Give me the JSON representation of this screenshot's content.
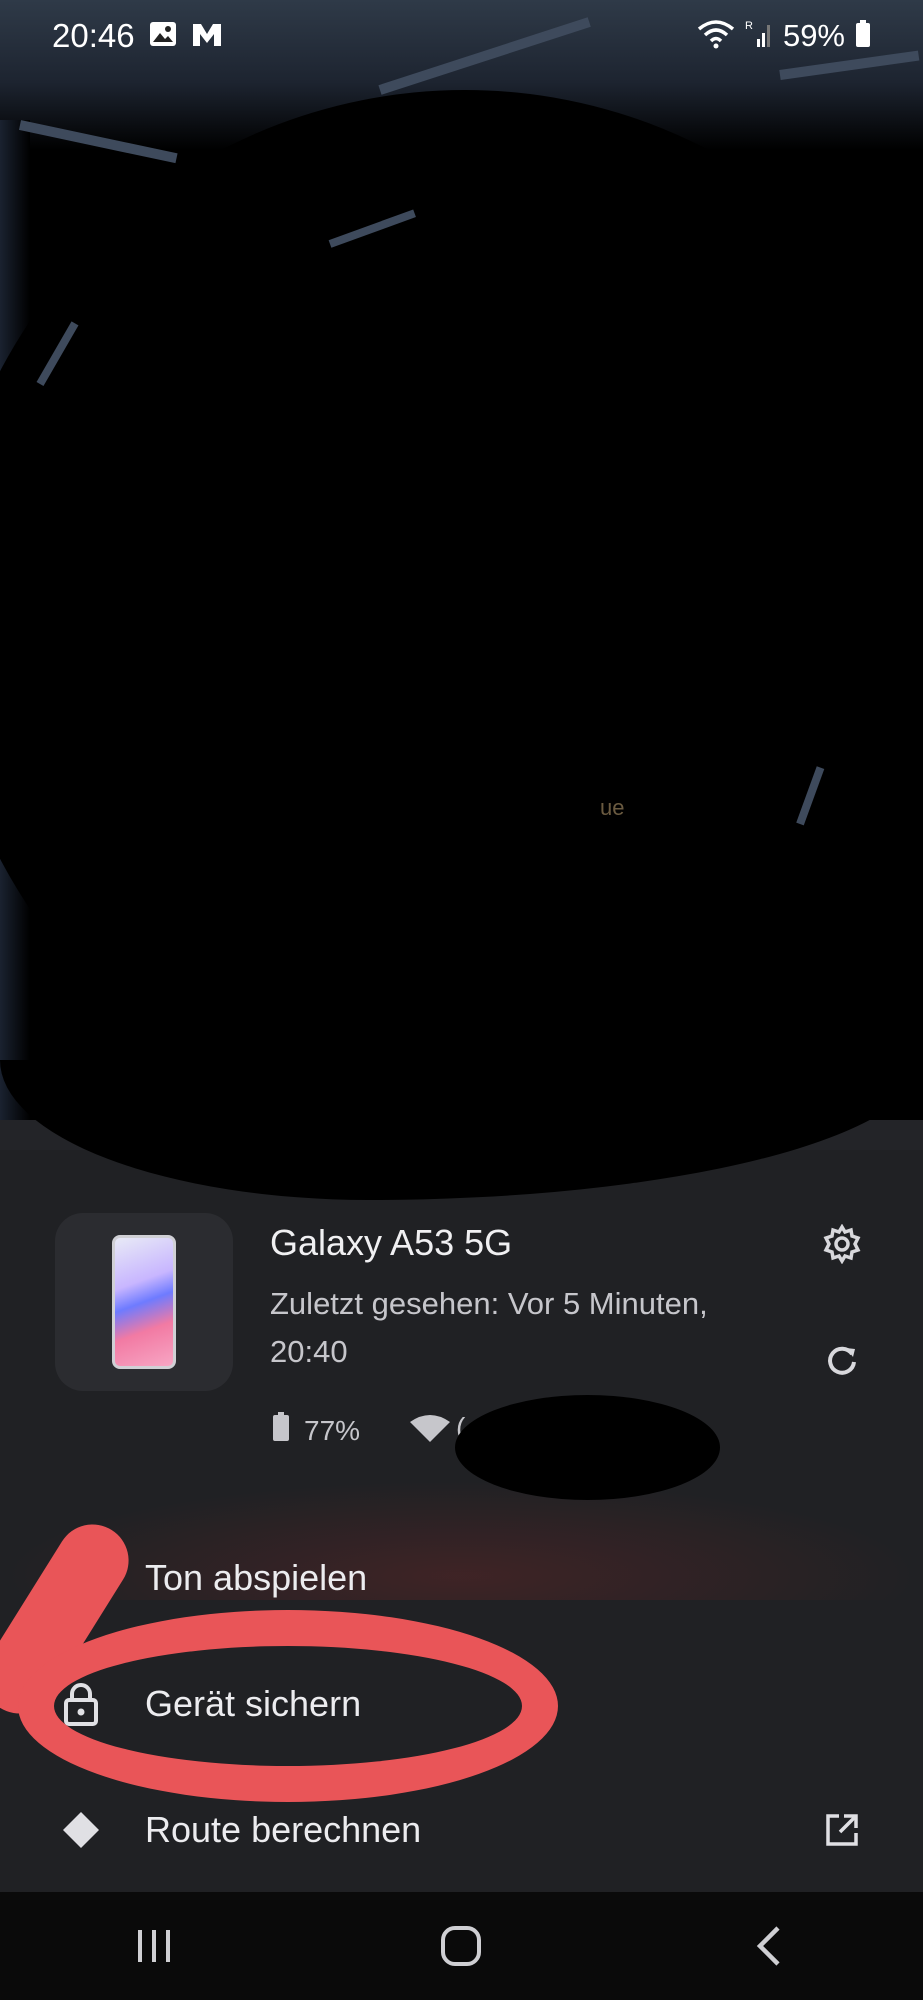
{
  "status_bar": {
    "time": "20:46",
    "battery": "59%",
    "icons": [
      "gallery-icon",
      "mail-icon",
      "wifi-icon",
      "signal-icon",
      "battery-icon"
    ]
  },
  "map": {
    "label_fragment": "ue"
  },
  "device": {
    "name": "Galaxy A53 5G",
    "last_seen": "Zuletzt gesehen: Vor 5 Minuten, 20:40",
    "battery": "77%",
    "network_fragment": "("
  },
  "actions": {
    "play_sound": "Ton abspielen",
    "secure_device": "Gerät sichern",
    "route": "Route berechnen"
  },
  "colors": {
    "sheet_bg": "#202124",
    "annotation": "#e95558"
  }
}
